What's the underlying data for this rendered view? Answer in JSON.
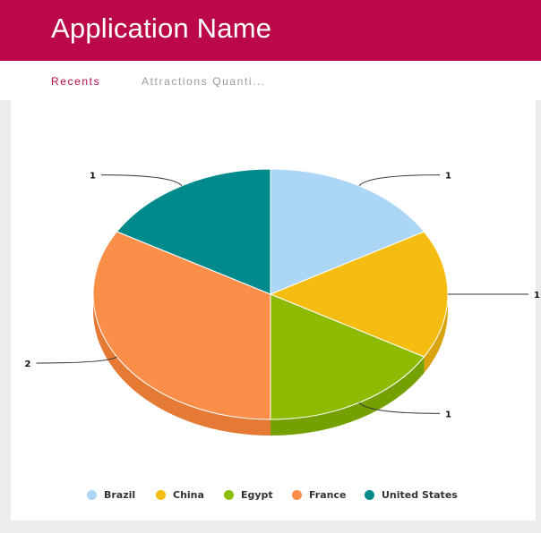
{
  "header": {
    "title": "Application Name",
    "color": "#bb0848"
  },
  "tabs": [
    {
      "label": "Recents",
      "active": true
    },
    {
      "label": "Attractions Quanti...",
      "active": false
    }
  ],
  "chart_data": {
    "type": "pie",
    "style": "3d",
    "categories": [
      "Brazil",
      "China",
      "Egypt",
      "France",
      "United States"
    ],
    "values": [
      1,
      1,
      1,
      2,
      1
    ],
    "colors": [
      "#acd6f5",
      "#f5bd12",
      "#8dbb02",
      "#fb8e48",
      "#018a8c"
    ],
    "side_colors": [
      "#8fb8d6",
      "#d8a30e",
      "#74a000",
      "#e57a35",
      "#016f70"
    ],
    "data_labels": [
      "1",
      "1",
      "1",
      "2",
      "1"
    ],
    "legend": "bottom"
  }
}
